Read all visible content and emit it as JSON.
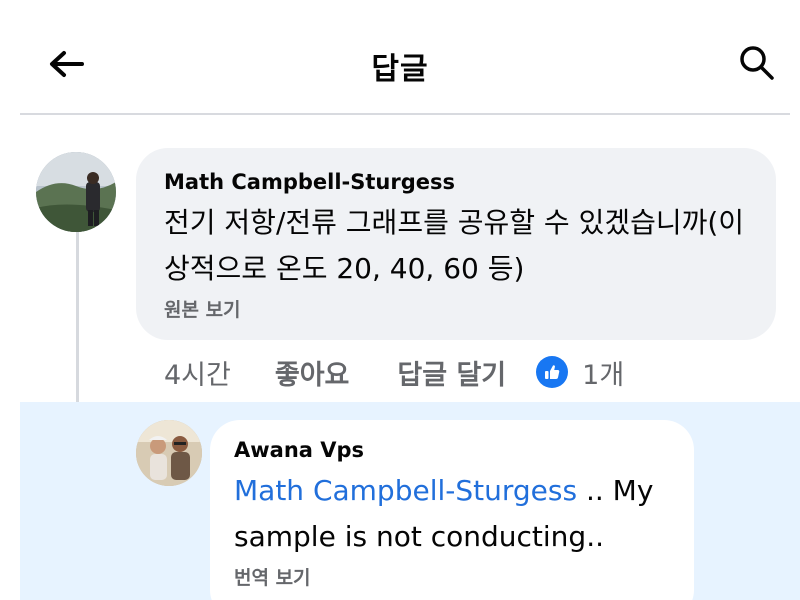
{
  "header": {
    "title": "답글",
    "back_icon": "arrow-left-icon",
    "search_icon": "search-icon"
  },
  "comment": {
    "author": "Math Campbell-Sturgess",
    "text": "전기 저항/전류 그래프를 공유할 수 있겠습니까(이상적으로 온도 20, 40, 60 등)",
    "see_original": "원본 보기",
    "time": "4시간",
    "like_label": "좋아요",
    "reply_label": "답글 달기",
    "reaction_count": "1개"
  },
  "reply": {
    "author": "Awana Vps",
    "mention": "Math Campbell-Sturgess",
    "text": " .. My sample is not conducting..",
    "see_translation": "번역 보기"
  },
  "colors": {
    "accent": "#1877f2",
    "mention": "#216fdb",
    "muted_text": "#65676b",
    "bubble_bg": "#f0f2f5",
    "reply_highlight": "#e7f3ff"
  }
}
